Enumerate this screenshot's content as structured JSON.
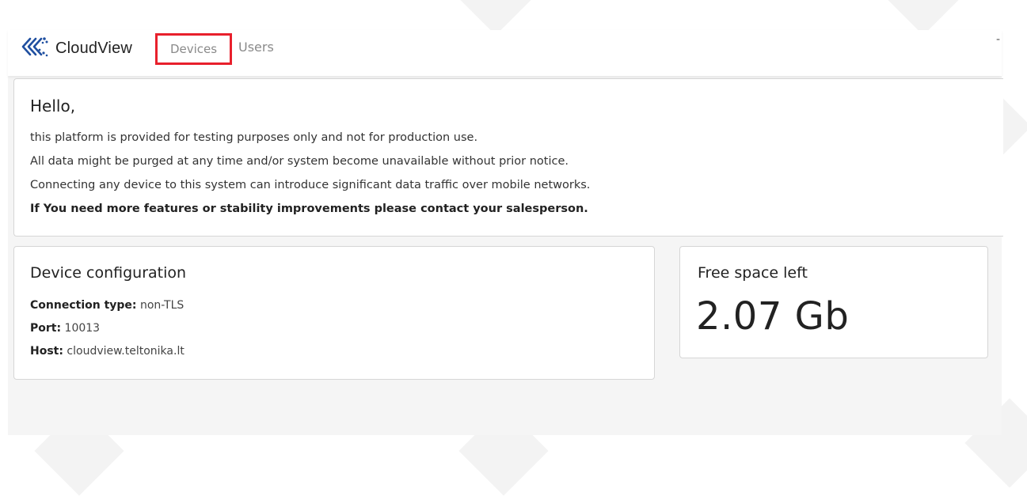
{
  "navbar": {
    "brand_name": "CloudView",
    "logo_icon": "cloudview-logo-icon",
    "nav_items": [
      {
        "label": "Devices",
        "highlighted": true
      },
      {
        "label": "Users"
      }
    ],
    "right_text": "-"
  },
  "hello_card": {
    "title": "Hello,",
    "lines": [
      "this platform is provided for testing purposes only and not for production use.",
      "All data might be purged at any time and/or system become unavailable without prior notice.",
      "Connecting any device to this system can introduce significant data traffic over mobile networks."
    ],
    "bold_line": "If You need more features or stability improvements please contact your salesperson."
  },
  "device_config": {
    "title": "Device configuration",
    "connection_type_label": "Connection type:",
    "connection_type_value": "non-TLS",
    "port_label": "Port:",
    "port_value": "10013",
    "host_label": "Host:",
    "host_value": "cloudview.teltonika.lt"
  },
  "free_space": {
    "title": "Free space left",
    "value": "2.07 Gb"
  },
  "colors": {
    "highlight_border": "#e8202c",
    "logo_blue": "#1f4fa0",
    "nav_text": "#8a8a8a"
  }
}
